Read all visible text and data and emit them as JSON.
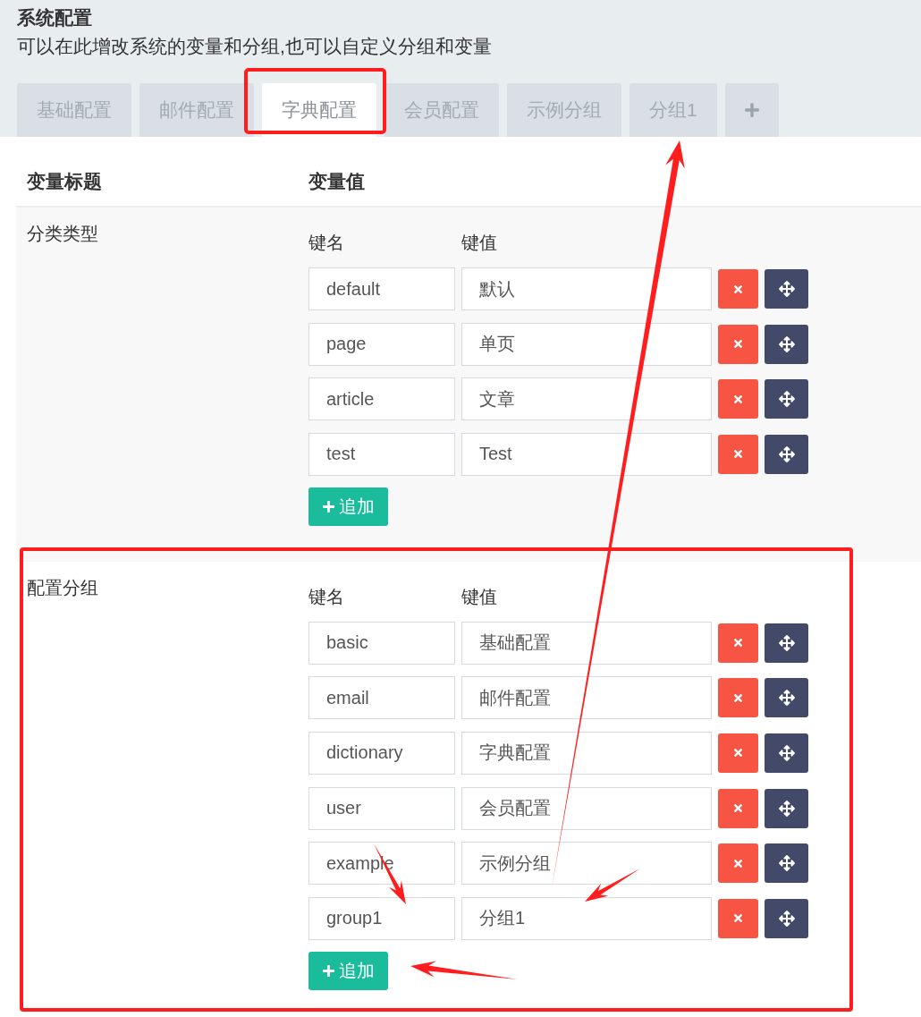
{
  "header": {
    "title": "系统配置",
    "description": "可以在此增改系统的变量和分组,也可以自定义分组和变量"
  },
  "tabs": [
    {
      "label": "基础配置",
      "selected": false
    },
    {
      "label": "邮件配置",
      "selected": false
    },
    {
      "label": "字典配置",
      "selected": true
    },
    {
      "label": "会员配置",
      "selected": false
    },
    {
      "label": "示例分组",
      "selected": false
    },
    {
      "label": "分组1",
      "selected": false
    }
  ],
  "table": {
    "columns": [
      "变量标题",
      "变量值"
    ],
    "rows": [
      {
        "title": "分类类型",
        "key_label": "键名",
        "value_label": "键值",
        "entries": [
          {
            "key": "default",
            "value": "默认"
          },
          {
            "key": "page",
            "value": "单页"
          },
          {
            "key": "article",
            "value": "文章"
          },
          {
            "key": "test",
            "value": "Test"
          }
        ],
        "add_button": "追加"
      },
      {
        "title": "配置分组",
        "key_label": "键名",
        "value_label": "键值",
        "entries": [
          {
            "key": "basic",
            "value": "基础配置"
          },
          {
            "key": "email",
            "value": "邮件配置"
          },
          {
            "key": "dictionary",
            "value": "字典配置"
          },
          {
            "key": "user",
            "value": "会员配置"
          },
          {
            "key": "example",
            "value": "示例分组"
          },
          {
            "key": "group1",
            "value": "分组1"
          }
        ],
        "add_button": "追加"
      }
    ]
  }
}
